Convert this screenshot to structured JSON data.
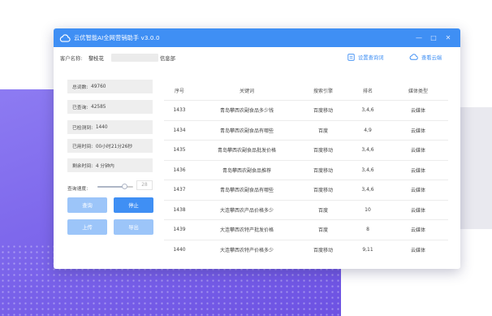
{
  "window": {
    "title": "云优智能AI全网营销助手 v3.0.0",
    "controls": {
      "minimize": "—",
      "maximize": "□",
      "close": "✕"
    }
  },
  "customer": {
    "label": "客户名称:",
    "name_prefix": "黎枝花",
    "name_suffix": "信息部"
  },
  "links": {
    "settings": "设置查询词",
    "cloud": "查看云端"
  },
  "stats": [
    {
      "label": "总词数:",
      "value": "49760"
    },
    {
      "label": "已查询:",
      "value": "42585"
    },
    {
      "label": "已检测到:",
      "value": "1440"
    },
    {
      "label": "已用时间:",
      "value": "00小时21分26秒"
    },
    {
      "label": "剩余时间:",
      "value": "4 分钟内"
    }
  ],
  "speed": {
    "label": "查询速度:",
    "value": "28",
    "level": 0.75
  },
  "buttons": {
    "query": "查询",
    "stop": "停止",
    "upload": "上传",
    "export": "导出"
  },
  "table": {
    "headers": [
      "序号",
      "关键词",
      "搜索引擎",
      "排名",
      "媒体类型"
    ],
    "rows": [
      [
        "1433",
        "青岛攀西农副食品多少钱",
        "百度移动",
        "3,4,6",
        "云媒体"
      ],
      [
        "1434",
        "青岛攀西农副食品有哪些",
        "百度",
        "4,9",
        "云媒体"
      ],
      [
        "1435",
        "青岛攀西农副食品批发价格",
        "百度移动",
        "3,4,6",
        "云媒体"
      ],
      [
        "1436",
        "青岛攀西农副食品推荐",
        "百度移动",
        "3,4,6",
        "云媒体"
      ],
      [
        "1437",
        "青岛攀西农副食品有哪些",
        "百度移动",
        "3,4,6",
        "云媒体"
      ],
      [
        "1438",
        "大连攀西农产品价格多少",
        "百度",
        "10",
        "云媒体"
      ],
      [
        "1439",
        "大连攀西农特产批发价格",
        "百度",
        "8",
        "云媒体"
      ],
      [
        "1440",
        "大连攀西农特产价格多少",
        "百度移动",
        "9,11",
        "云媒体"
      ]
    ]
  }
}
